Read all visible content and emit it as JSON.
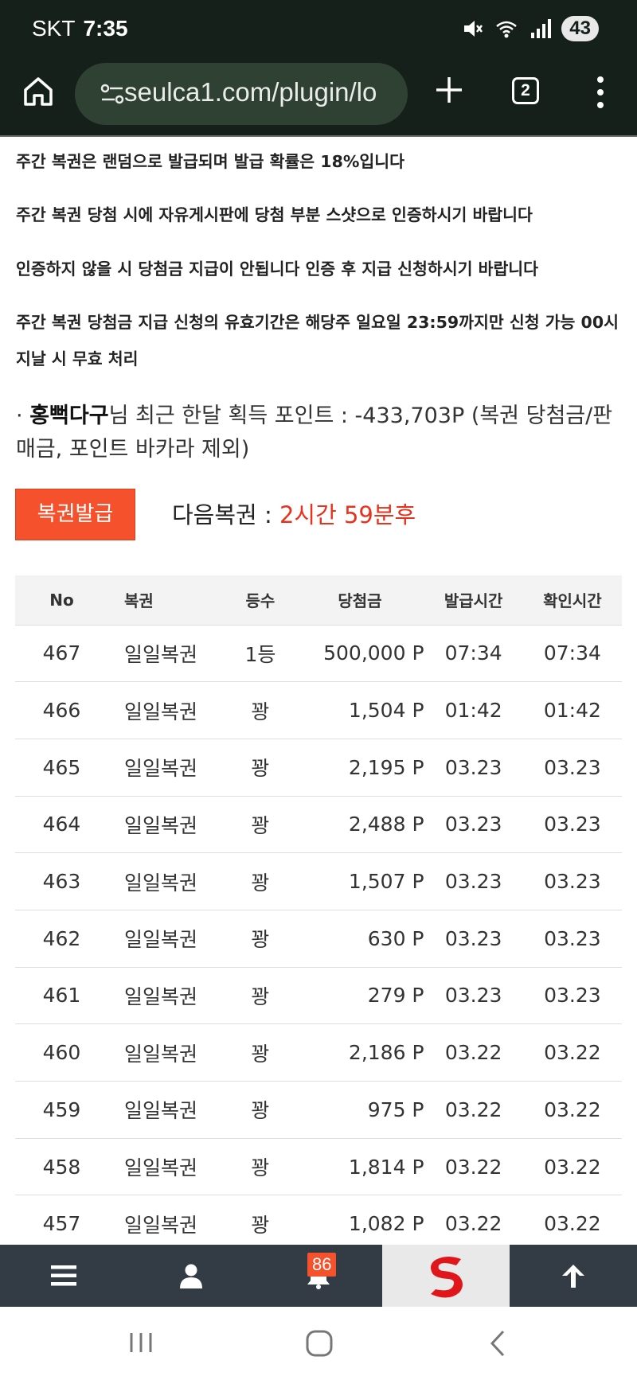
{
  "status_bar": {
    "carrier": "SKT",
    "time": "7:35",
    "battery": "43",
    "icons": [
      "mute-icon",
      "wifi-icon",
      "signal-icon"
    ]
  },
  "browser": {
    "url": "seulca1.com/plugin/lo",
    "tab_count": "2"
  },
  "notices": [
    "주간 복권은 랜덤으로 발급되며 발급 확률은 18%입니다",
    "주간 복권 당첨 시에 자유게시판에 당첨 부분 스샷으로 인증하시기 바랍니다",
    "인증하지 않을 시 당첨금 지급이 안됩니다 인증 후 지급 신청하시기 바랍니다",
    "주간 복권 당첨금 지급 신청의 유효기간은 해당주 일요일 23:59까지만 신청 가능 00시 지날 시 무효 처리"
  ],
  "points": {
    "bullet": "·",
    "user": "홍뻑다구",
    "text": "님 최근 한달 획득 포인트 : -433,703P (복권 당첨금/판매금, 포인트 바카라 제외)"
  },
  "issue_button": "복권발급",
  "next": {
    "label": "다음복권 : ",
    "value": "2시간 59분후"
  },
  "table": {
    "headers": [
      "No",
      "복권",
      "등수",
      "당첨금",
      "발급시간",
      "확인시간"
    ],
    "rows": [
      [
        "467",
        "일일복권",
        "1등",
        "500,000 P",
        "07:34",
        "07:34"
      ],
      [
        "466",
        "일일복권",
        "꽝",
        "1,504 P",
        "01:42",
        "01:42"
      ],
      [
        "465",
        "일일복권",
        "꽝",
        "2,195 P",
        "03.23",
        "03.23"
      ],
      [
        "464",
        "일일복권",
        "꽝",
        "2,488 P",
        "03.23",
        "03.23"
      ],
      [
        "463",
        "일일복권",
        "꽝",
        "1,507 P",
        "03.23",
        "03.23"
      ],
      [
        "462",
        "일일복권",
        "꽝",
        "630 P",
        "03.23",
        "03.23"
      ],
      [
        "461",
        "일일복권",
        "꽝",
        "279 P",
        "03.23",
        "03.23"
      ],
      [
        "460",
        "일일복권",
        "꽝",
        "2,186 P",
        "03.22",
        "03.22"
      ],
      [
        "459",
        "일일복권",
        "꽝",
        "975 P",
        "03.22",
        "03.22"
      ],
      [
        "458",
        "일일복권",
        "꽝",
        "1,814 P",
        "03.22",
        "03.22"
      ],
      [
        "457",
        "일일복권",
        "꽝",
        "1,082 P",
        "03.22",
        "03.22"
      ]
    ]
  },
  "site_nav": {
    "items": [
      "menu-icon",
      "user-icon",
      "bell-icon",
      "site-logo",
      "arrow-up-icon"
    ],
    "notification_count": "86"
  },
  "colors": {
    "accent": "#f4512c",
    "countdown": "#e8321e",
    "browser_bg": "#142019",
    "nav_bg": "#333b44"
  }
}
